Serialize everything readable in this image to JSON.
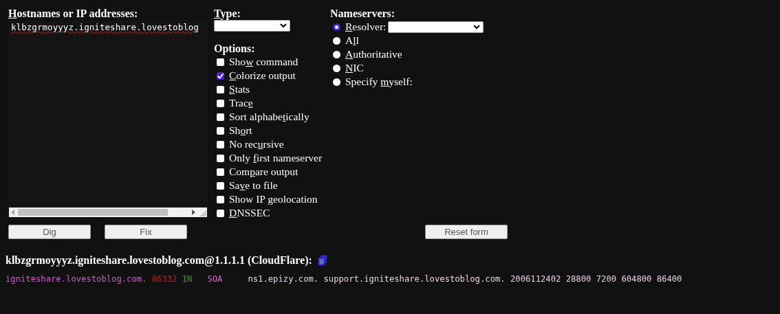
{
  "hostnames": {
    "label": {
      "key": "H",
      "post": "ostnames or IP addresses:"
    },
    "value": "klbzgrmoyyyz.igniteshare.lovestoblog"
  },
  "type": {
    "label": {
      "key": "T",
      "post": "ype:"
    }
  },
  "options": {
    "title": "Options:",
    "items": [
      {
        "label": {
          "pre": "Sho",
          "key": "w",
          "post": " command"
        },
        "checked": false
      },
      {
        "label": {
          "key": "C",
          "post": "olorize output"
        },
        "checked": true
      },
      {
        "label": {
          "key": "S",
          "post": "tats"
        },
        "checked": false
      },
      {
        "label": {
          "pre": "Trac",
          "key": "e"
        },
        "checked": false
      },
      {
        "label": {
          "pre": "Sort alphabe",
          "key": "t",
          "post": "ically"
        },
        "checked": false
      },
      {
        "label": {
          "pre": "Sh",
          "key": "o",
          "post": "rt"
        },
        "checked": false
      },
      {
        "label": {
          "pre": "No rec",
          "key": "u",
          "post": "rsive"
        },
        "checked": false
      },
      {
        "label": {
          "pre": "Only ",
          "key": "f",
          "post": "irst nameserver"
        },
        "checked": false
      },
      {
        "label": {
          "pre": "Com",
          "key": "p",
          "post": "are output"
        },
        "checked": false
      },
      {
        "label": {
          "pre": "Sa",
          "key": "v",
          "post": "e to file"
        },
        "checked": false
      },
      {
        "label": {
          "pre": "Show IP geolocation"
        },
        "checked": false
      },
      {
        "label": {
          "key": "D",
          "post": "NSSEC"
        },
        "checked": false
      }
    ]
  },
  "nameservers": {
    "title": "Nameservers:",
    "items": [
      {
        "label": {
          "key": "R",
          "post": "esolver:"
        },
        "selected": true,
        "kind": "select"
      },
      {
        "label": {
          "pre": "A",
          "key": "l",
          "post": "l"
        },
        "selected": false,
        "kind": "plain"
      },
      {
        "label": {
          "key": "A",
          "post": "uthoritative"
        },
        "selected": false,
        "kind": "plain"
      },
      {
        "label": {
          "key": "N",
          "post": "IC"
        },
        "selected": false,
        "kind": "plain"
      },
      {
        "label": {
          "pre": "Specify ",
          "key": "m",
          "post": "yself:"
        },
        "selected": false,
        "kind": "plain"
      }
    ]
  },
  "buttons": [
    {
      "label": "Dig",
      "kind": "dig"
    },
    {
      "label": "Fix",
      "kind": "fix"
    },
    {
      "label": "Reset form",
      "kind": "reset"
    }
  ],
  "result": {
    "title": "klbzgrmoyyyz.igniteshare.lovestoblog.com@1.1.1.1 (CloudFlare):",
    "segments": [
      {
        "text": "igniteshare.lovestoblog.com.",
        "color": "#d355d3"
      },
      {
        "text": "86332",
        "color": "#c41a1a"
      },
      {
        "text": "IN",
        "color": "#1ea51e"
      },
      {
        "text": "SOA",
        "color": "#e05ee0"
      },
      {
        "text": "ns1.epizy.com. support.igniteshare.lovestoblog.com. 2006112402 28800 7200 604800 86400",
        "color": "#ecd0ec"
      }
    ]
  }
}
